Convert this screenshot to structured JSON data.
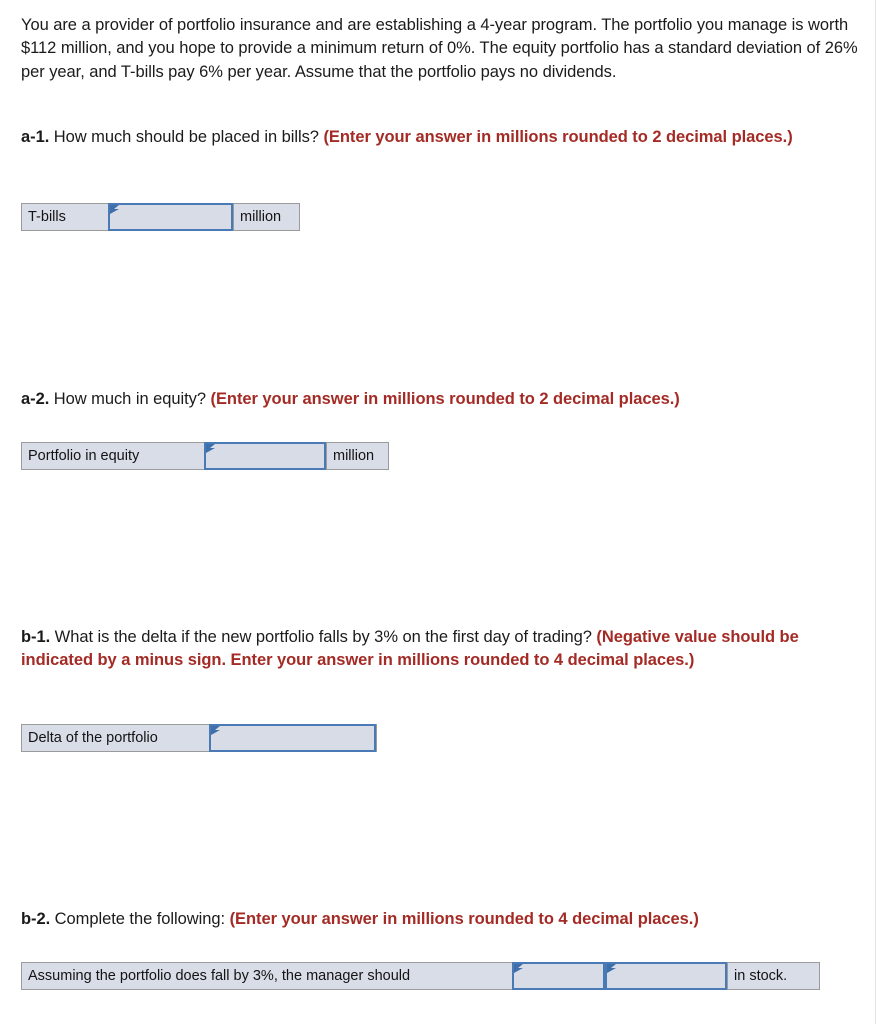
{
  "stem": {
    "text": "You are a provider of portfolio insurance and are establishing a 4-year program. The portfolio you manage is worth $112 million, and you hope to provide a minimum return of 0%. The equity portfolio has a standard deviation of 26% per year, and T-bills pay 6% per year. Assume that the portfolio pays no dividends."
  },
  "questions": {
    "a1": {
      "label": "a-1.",
      "prompt": " How much should be placed in bills? ",
      "instruction": "(Enter your answer in millions rounded to 2 decimal places.)",
      "row": {
        "label": "T-bills",
        "unit": "million",
        "value": "",
        "placeholder": ""
      }
    },
    "a2": {
      "label": "a-2.",
      "prompt": " How much in equity? ",
      "instruction": "(Enter your answer in millions rounded to 2 decimal places.)",
      "row": {
        "label": "Portfolio in equity",
        "unit": "million",
        "value": "",
        "placeholder": ""
      }
    },
    "b1": {
      "label": "b-1.",
      "prompt": " What is the delta if the new portfolio falls by 3% on the first day of trading? ",
      "instruction": "(Negative value should be indicated by a minus sign. Enter your answer in millions rounded to 4 decimal places.)",
      "row": {
        "label": "Delta of the portfolio",
        "value": "",
        "placeholder": ""
      }
    },
    "b2": {
      "label": "b-2.",
      "prompt": " Complete the following: ",
      "instruction": "(Enter your answer in millions rounded to 4 decimal places.)",
      "row": {
        "label": "Assuming the portfolio does fall by 3%, the manager should",
        "action_value": "",
        "action_placeholder": "",
        "amount_value": "",
        "amount_placeholder": "",
        "suffix": "in stock."
      }
    }
  },
  "colors": {
    "instruction_red": "#a42b25",
    "input_border_blue": "#4a7ab5",
    "row_fill": "#d8dde8",
    "row_border": "#9b9b9b",
    "flag_blue": "#3f6fab"
  },
  "icons": {
    "input_marker": "answer-flag-icon"
  }
}
